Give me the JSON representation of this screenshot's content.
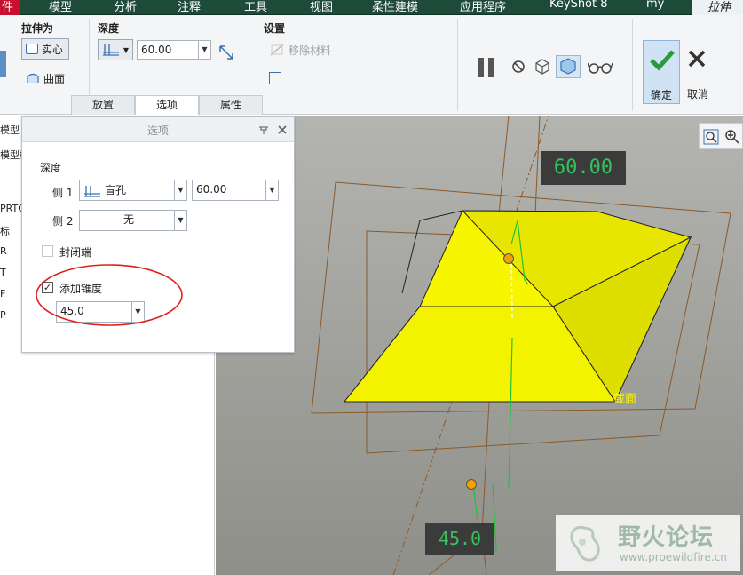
{
  "menu": {
    "file": "件",
    "items": [
      "模型",
      "分析",
      "注释",
      "工具",
      "视图",
      "柔性建模",
      "应用程序",
      "KeyShot 8",
      "my"
    ],
    "active_tab": "拉伸"
  },
  "ribbon": {
    "extrude_as": {
      "label": "拉伸为",
      "solid": "实心",
      "surface": "曲面"
    },
    "depth": {
      "label": "深度",
      "value": "60.00"
    },
    "settings": {
      "label": "设置",
      "remove_material": "移除材料"
    },
    "tabs": [
      "放置",
      "选项",
      "属性"
    ],
    "confirm_label": "确定",
    "cancel_label": "取消"
  },
  "tree": {
    "items": [
      "模型",
      "模型树",
      "PRTO",
      "标",
      "R",
      "T",
      "F",
      "P"
    ]
  },
  "panel": {
    "title": "选项",
    "depth_label": "深度",
    "side1_label": "侧 1",
    "side1_type": "盲孔",
    "side1_value": "60.00",
    "side2_label": "侧 2",
    "side2_type": "无",
    "capped_label": "封闭端",
    "taper_label": "添加锥度",
    "taper_checked": true,
    "taper_value": "45.0"
  },
  "viewport": {
    "dim_depth": "60.00",
    "dim_taper": "45.0",
    "section_label": "截面"
  },
  "watermark": {
    "title": "野火论坛",
    "url": "www.proewildfire.cn"
  },
  "colors": {
    "menubar": "#1e4a3a",
    "accent": "#c8102e",
    "solid_fill": "#f7f500",
    "dim_text": "#34c25a"
  }
}
